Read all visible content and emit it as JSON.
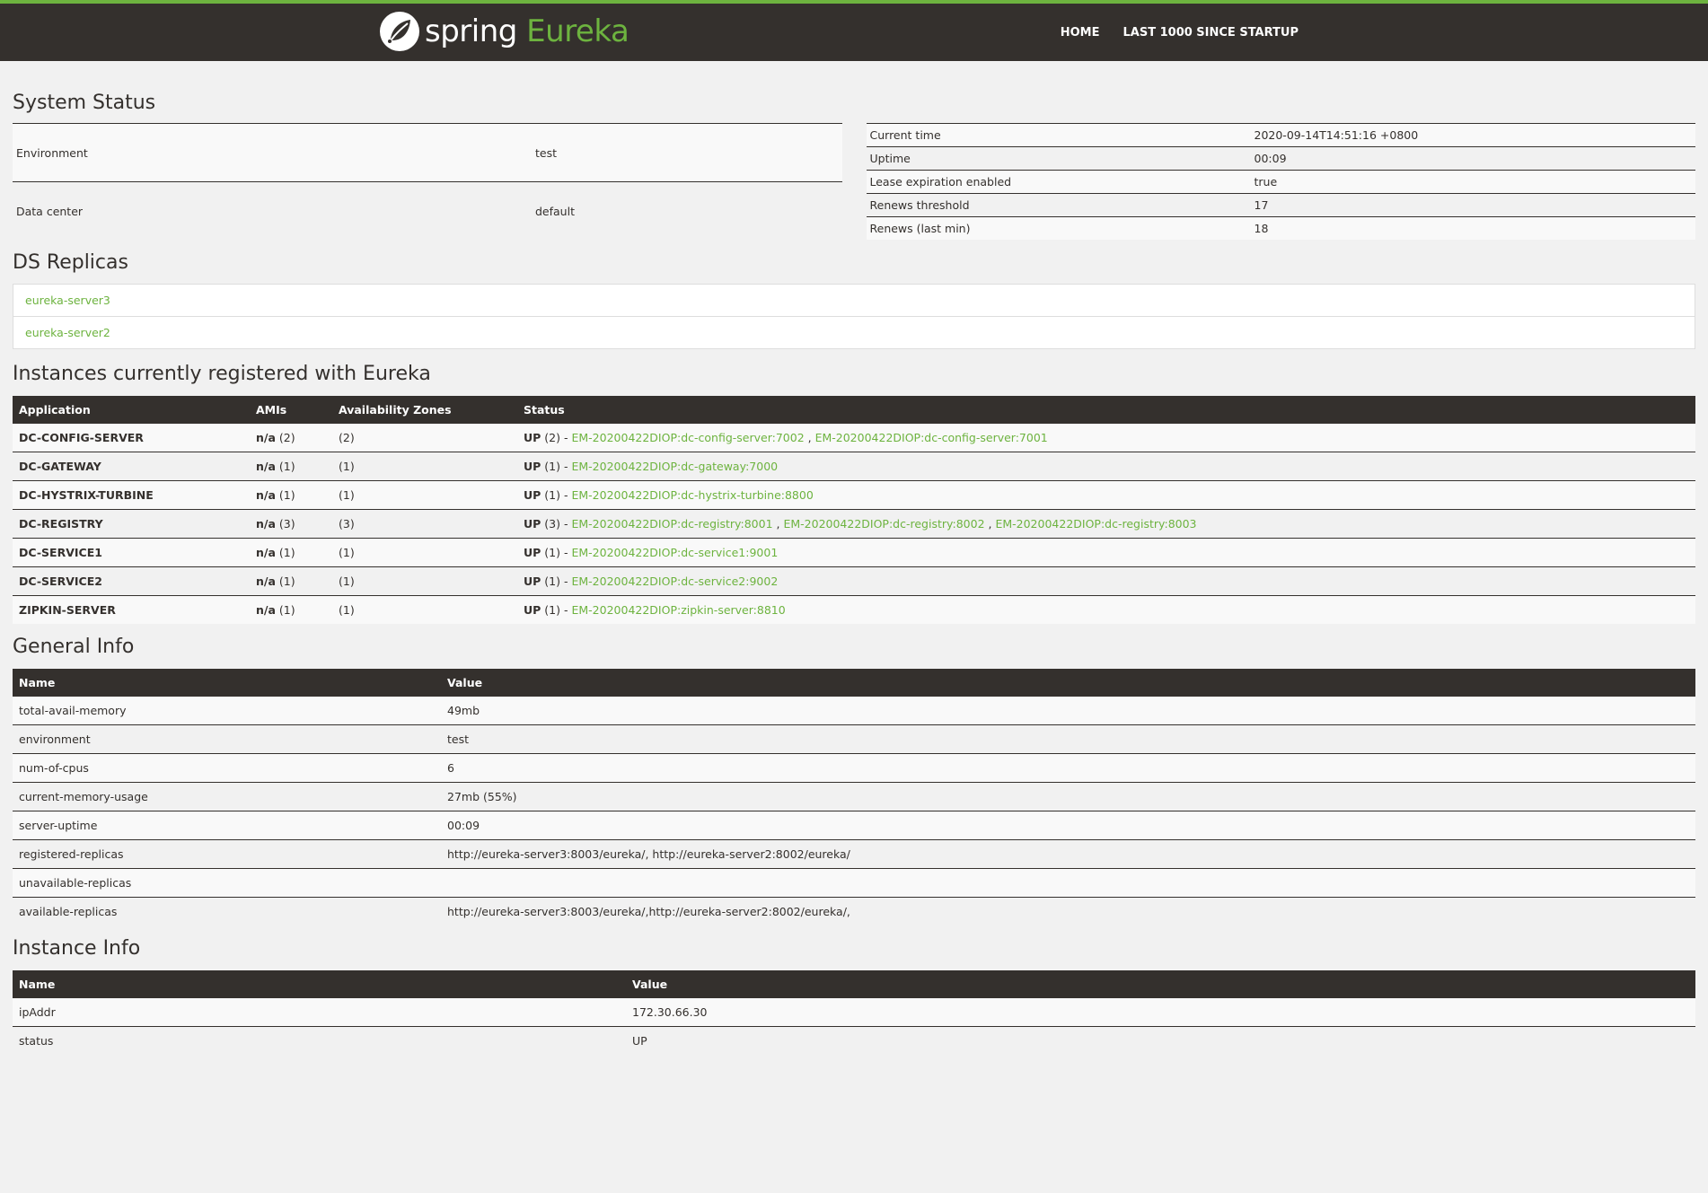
{
  "header": {
    "brand_spring": "spring",
    "brand_eureka": "Eureka",
    "nav": [
      "HOME",
      "LAST 1000 SINCE STARTUP"
    ]
  },
  "system_status": {
    "title": "System Status",
    "left": [
      {
        "key": "Environment",
        "value": "test"
      },
      {
        "key": "Data center",
        "value": "default"
      }
    ],
    "right": [
      {
        "key": "Current time",
        "value": "2020-09-14T14:51:16 +0800"
      },
      {
        "key": "Uptime",
        "value": "00:09"
      },
      {
        "key": "Lease expiration enabled",
        "value": "true"
      },
      {
        "key": "Renews threshold",
        "value": "17"
      },
      {
        "key": "Renews (last min)",
        "value": "18"
      }
    ]
  },
  "ds_replicas": {
    "title": "DS Replicas",
    "items": [
      "eureka-server3",
      "eureka-server2"
    ]
  },
  "instances": {
    "title": "Instances currently registered with Eureka",
    "headers": [
      "Application",
      "AMIs",
      "Availability Zones",
      "Status"
    ],
    "rows": [
      {
        "app": "DC-CONFIG-SERVER",
        "ami_na": "n/a",
        "ami_count": "(2)",
        "zones": "(2)",
        "status_up": "UP",
        "status_count": "(2) -",
        "links": [
          "EM-20200422DIOP:dc-config-server:7002",
          "EM-20200422DIOP:dc-config-server:7001"
        ]
      },
      {
        "app": "DC-GATEWAY",
        "ami_na": "n/a",
        "ami_count": "(1)",
        "zones": "(1)",
        "status_up": "UP",
        "status_count": "(1) -",
        "links": [
          "EM-20200422DIOP:dc-gateway:7000"
        ]
      },
      {
        "app": "DC-HYSTRIX-TURBINE",
        "ami_na": "n/a",
        "ami_count": "(1)",
        "zones": "(1)",
        "status_up": "UP",
        "status_count": "(1) -",
        "links": [
          "EM-20200422DIOP:dc-hystrix-turbine:8800"
        ]
      },
      {
        "app": "DC-REGISTRY",
        "ami_na": "n/a",
        "ami_count": "(3)",
        "zones": "(3)",
        "status_up": "UP",
        "status_count": "(3) -",
        "links": [
          "EM-20200422DIOP:dc-registry:8001",
          "EM-20200422DIOP:dc-registry:8002",
          "EM-20200422DIOP:dc-registry:8003"
        ]
      },
      {
        "app": "DC-SERVICE1",
        "ami_na": "n/a",
        "ami_count": "(1)",
        "zones": "(1)",
        "status_up": "UP",
        "status_count": "(1) -",
        "links": [
          "EM-20200422DIOP:dc-service1:9001"
        ]
      },
      {
        "app": "DC-SERVICE2",
        "ami_na": "n/a",
        "ami_count": "(1)",
        "zones": "(1)",
        "status_up": "UP",
        "status_count": "(1) -",
        "links": [
          "EM-20200422DIOP:dc-service2:9002"
        ]
      },
      {
        "app": "ZIPKIN-SERVER",
        "ami_na": "n/a",
        "ami_count": "(1)",
        "zones": "(1)",
        "status_up": "UP",
        "status_count": "(1) -",
        "links": [
          "EM-20200422DIOP:zipkin-server:8810"
        ]
      }
    ]
  },
  "general_info": {
    "title": "General Info",
    "headers": [
      "Name",
      "Value"
    ],
    "rows": [
      {
        "name": "total-avail-memory",
        "value": "49mb"
      },
      {
        "name": "environment",
        "value": "test"
      },
      {
        "name": "num-of-cpus",
        "value": "6"
      },
      {
        "name": "current-memory-usage",
        "value": "27mb (55%)"
      },
      {
        "name": "server-uptime",
        "value": "00:09"
      },
      {
        "name": "registered-replicas",
        "value": "http://eureka-server3:8003/eureka/, http://eureka-server2:8002/eureka/"
      },
      {
        "name": "unavailable-replicas",
        "value": ""
      },
      {
        "name": "available-replicas",
        "value": "http://eureka-server3:8003/eureka/,http://eureka-server2:8002/eureka/,"
      }
    ]
  },
  "instance_info": {
    "title": "Instance Info",
    "headers": [
      "Name",
      "Value"
    ],
    "rows": [
      {
        "name": "ipAddr",
        "value": "172.30.66.30"
      },
      {
        "name": "status",
        "value": "UP"
      }
    ]
  },
  "colors": {
    "brand_green": "#6db33f",
    "dark": "#34302d",
    "background": "#f1f1f1"
  }
}
